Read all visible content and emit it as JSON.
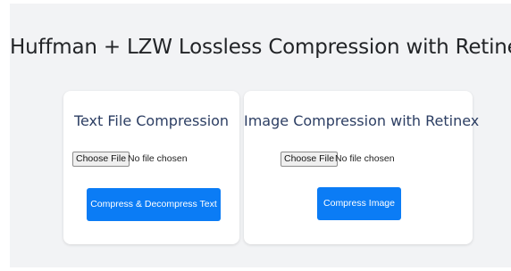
{
  "page": {
    "title": "Huffman + LZW Lossless Compression with Retinex"
  },
  "text_card": {
    "title": "Text File Compression",
    "choose_file_label": "Choose File",
    "file_status": "No file chosen",
    "action_label": "Compress & Decompress Text"
  },
  "image_card": {
    "title": "Image Compression with Retinex",
    "choose_file_label": "Choose File",
    "file_status": "No file chosen",
    "action_label": "Compress Image"
  },
  "colors": {
    "background": "#f2f3f5",
    "card": "#ffffff",
    "title_text": "#222427",
    "card_title_text": "#2c3e63",
    "primary_button": "#0b7cf5"
  }
}
